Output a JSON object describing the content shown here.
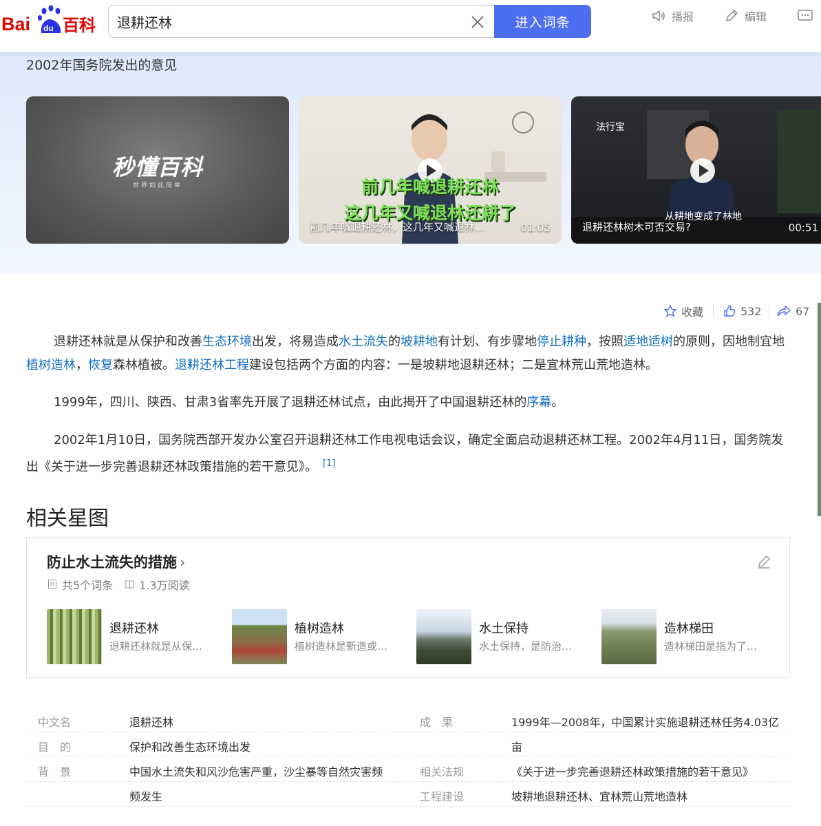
{
  "header": {
    "logo_text": "Bai百科",
    "search_value": "退耕还林",
    "enter_label": "进入词条",
    "tools": {
      "broadcast": "播报",
      "edit": "编辑"
    }
  },
  "videos": {
    "section_title": "2002年国务院发出的意见",
    "items": [
      {
        "brand": "秒懂百科",
        "brand_sub": "世界如此简单"
      },
      {
        "overlay_line1": "前几年喊退耕还林",
        "overlay_line2": "这几年又喊退林还耕了",
        "caption": "前几年喊退耕还林，这几年又喊退林…",
        "duration": "01:05"
      },
      {
        "channel": "法行宝",
        "subtitle": "从耕地变成了林地",
        "caption": "退耕还林树木可否交易?",
        "duration": "00:51"
      }
    ]
  },
  "actions": {
    "favorite": "收藏",
    "likes": "532",
    "shares": "67"
  },
  "article": {
    "p1": {
      "a": "退耕还林就是从保护和改善",
      "l1": "生态环境",
      "b": "出发，将易造成",
      "l2": "水土流失",
      "c": "的",
      "l3": "坡耕地",
      "d": "有计划、有步骤地",
      "l4": "停止耕种",
      "e": "，按照",
      "l5": "适地适树",
      "f": "的原则，因地制宜地",
      "l6": "植树造林",
      "g": "，",
      "l7": "恢复",
      "h": "森林植被。",
      "l8": "退耕还林工程",
      "i": "建设包括两个方面的内容：一是坡耕地退耕还林；二是宜林荒山荒地造林。"
    },
    "p2": {
      "a": "1999年，四川、陕西、甘肃3省率先开展了退耕还林试点，由此揭开了中国退耕还林的",
      "l1": "序幕",
      "b": "。"
    },
    "p3": {
      "a": "2002年1月10日，国务院西部开发办公室召开退耕还林工作电视电话会议，确定全面启动退耕还林工程。2002年4月11日，国务院发出《关于进一步完善退耕还林政策措施的若干意见》。",
      "ref": "[1]"
    }
  },
  "related": {
    "heading": "相关星图",
    "card_title": "防止水土流失的措施",
    "entries_count": "共5个词条",
    "reads": "1.3万阅读",
    "entries": [
      {
        "name": "退耕还林",
        "desc": "退耕还林就是从保…"
      },
      {
        "name": "植树造林",
        "desc": "植树造林是新造或…"
      },
      {
        "name": "水土保持",
        "desc": "水土保持，是防治…"
      },
      {
        "name": "造林梯田",
        "desc": "造林梯田是指为了…"
      }
    ]
  },
  "infobox": {
    "k_name": "中文名",
    "v_name": "退耕还林",
    "k_purpose": "目　的",
    "v_purpose": "保护和改善生态环境出发",
    "k_background": "背　景",
    "v_background_1": "中国水土流失和风沙危害严重，沙尘暴等自然灾害频",
    "v_background_2": "频发生",
    "k_result": "成　果",
    "v_result_1": "1999年—2008年，中国累计实施退耕还林任务4.03亿",
    "v_result_2": "亩",
    "k_law": "相关法规",
    "v_law": "《关于进一步完善退耕还林政策措施的若干意见》",
    "k_project": "工程建设",
    "v_project": "坡耕地退耕还林、宜林荒山荒地造林"
  },
  "colors": {
    "brand_blue": "#4e6ef2",
    "link": "#136ec2",
    "logo_red": "#e10602"
  }
}
